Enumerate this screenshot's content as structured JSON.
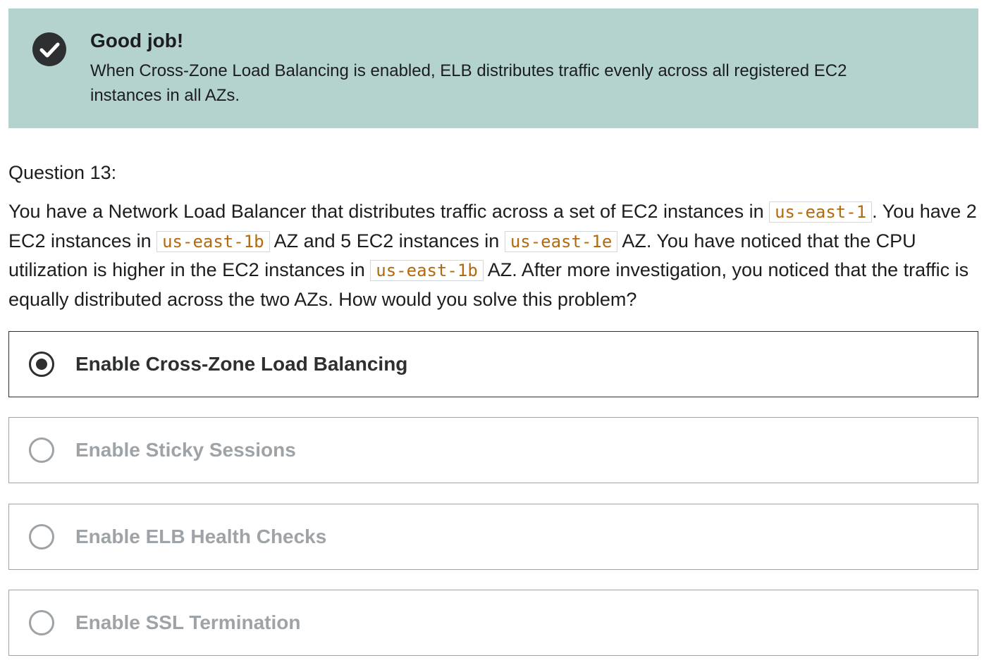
{
  "result": {
    "title": "Good job!",
    "explanation": "When Cross-Zone Load Balancing is enabled, ELB distributes traffic evenly across all registered EC2 instances in all AZs.",
    "icon": "check-circle-icon",
    "background_color": "#b4d3ce"
  },
  "question": {
    "number_label": "Question 13:",
    "prompt_parts": [
      "You have a Network Load Balancer that distributes traffic across a set of EC2 instances in ",
      "us-east-1",
      ". You have 2 EC2 instances in ",
      "us-east-1b",
      " AZ and 5 EC2 instances in ",
      "us-east-1e",
      " AZ. You have noticed that the CPU utilization is higher in the EC2 instances in ",
      "us-east-1b",
      " AZ. After more investigation, you noticed that the traffic is equally distributed across the two AZs. How would you solve this problem?"
    ],
    "code_color": "#b4690e"
  },
  "answers": [
    {
      "label": "Enable Cross-Zone Load Balancing",
      "selected": true
    },
    {
      "label": "Enable Sticky Sessions",
      "selected": false
    },
    {
      "label": "Enable ELB Health Checks",
      "selected": false
    },
    {
      "label": "Enable SSL Termination",
      "selected": false
    }
  ]
}
